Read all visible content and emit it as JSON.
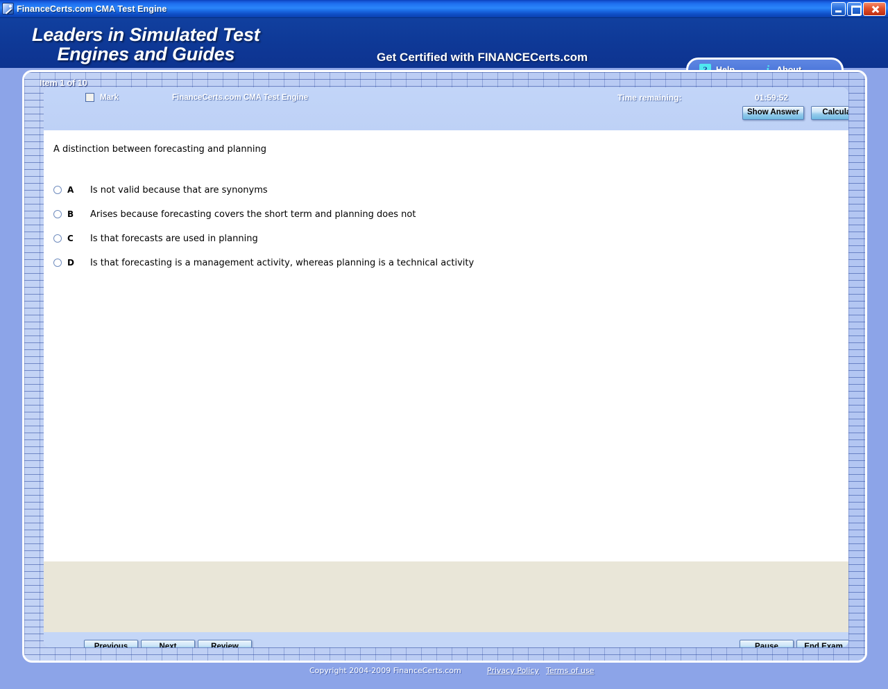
{
  "window": {
    "title": "FinanceCerts.com CMA Test Engine",
    "icon": "app-pencil-icon",
    "controls": {
      "minimize": "minimize",
      "maximize": "maximize",
      "close": "close"
    }
  },
  "banner": {
    "slogan_line1": "Leaders in Simulated Test",
    "slogan_line2": "Engines and Guides",
    "tagline": "Get Certified with FINANCECerts.com",
    "help_label": "Help",
    "help_icon": "question-mark-icon",
    "about_label": "About",
    "about_icon": "info-icon"
  },
  "exam": {
    "item_label": "Item 1 of 10",
    "mark_label": "Mark",
    "mark_checked": false,
    "engine_name": "FinanceCerts.com CMA Test Engine",
    "time_label": "Time remaining:",
    "time_value": "01:59:52",
    "show_answer_label": "Show Answer",
    "calculator_label": "Calculator"
  },
  "question": {
    "stem": "A distinction between forecasting and planning",
    "options": [
      {
        "letter": "A",
        "text": "Is not valid because that are synonyms",
        "selected": false
      },
      {
        "letter": "B",
        "text": "Arises because forecasting covers the short term and planning does not",
        "selected": false
      },
      {
        "letter": "C",
        "text": "Is that forecasts are used in planning",
        "selected": false
      },
      {
        "letter": "D",
        "text": "Is that forecasting is a management activity, whereas planning is a technical activity",
        "selected": false
      }
    ],
    "explanation": ""
  },
  "nav": {
    "previous_label": "Previous",
    "next_label": "Next",
    "review_label": "Review",
    "pause_label": "Pause",
    "end_exam_label": "End Exam"
  },
  "footer": {
    "copyright": "Copyright 2004-2009 FinanceCerts.com",
    "links": [
      {
        "label": "Privacy Policy"
      },
      {
        "label": "Terms of use"
      }
    ]
  },
  "colors": {
    "titlebar_blue": "#1f70f0",
    "banner_blue": "#0f3ba0",
    "panel_blue": "#c4d6f7",
    "page_blue": "#8ca4e8",
    "beige": "#e9e6d8",
    "accent_cyan": "#4fe8ef"
  }
}
